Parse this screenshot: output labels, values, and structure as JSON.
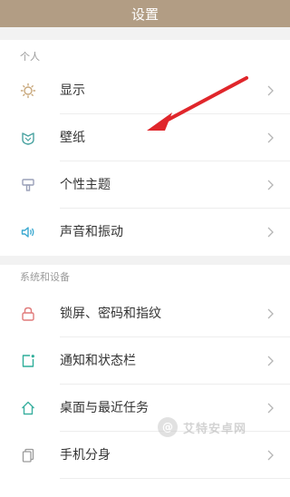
{
  "header": {
    "title": "设置"
  },
  "sections": [
    {
      "label": "个人",
      "items": [
        {
          "label": "显示",
          "icon": "brightness-icon",
          "color": "#c8a77a"
        },
        {
          "label": "壁纸",
          "icon": "wallpaper-icon",
          "color": "#4aa3a1"
        },
        {
          "label": "个性主题",
          "icon": "theme-brush-icon",
          "color": "#9aa0b8"
        },
        {
          "label": "声音和振动",
          "icon": "speaker-icon",
          "color": "#3aa8d0"
        }
      ]
    },
    {
      "label": "系统和设备",
      "items": [
        {
          "label": "锁屏、密码和指纹",
          "icon": "lock-icon",
          "color": "#e07a7a"
        },
        {
          "label": "通知和状态栏",
          "icon": "notification-icon",
          "color": "#2fae9a"
        },
        {
          "label": "桌面与最近任务",
          "icon": "home-icon",
          "color": "#3bb0a0"
        },
        {
          "label": "手机分身",
          "icon": "dual-apps-icon",
          "color": "#9a9a9a"
        }
      ]
    }
  ],
  "watermark": {
    "text": "艾特安卓网"
  },
  "colors": {
    "header_bg": "#b29d84",
    "arrow": "#e0262b",
    "page_bg": "#ffffff",
    "gap_bg": "#f2f2f2"
  }
}
